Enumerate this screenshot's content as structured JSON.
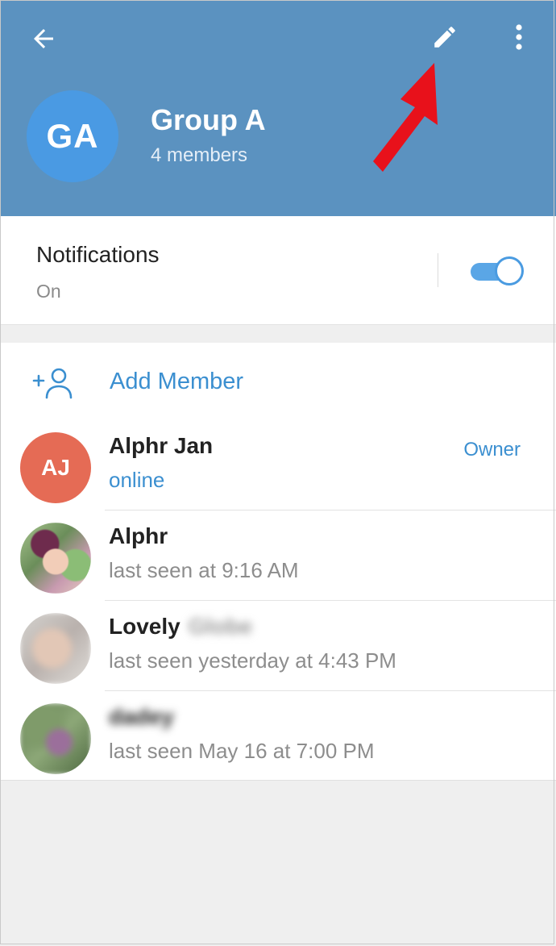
{
  "header": {
    "avatar_initials": "GA",
    "title": "Group A",
    "subtitle": "4 members",
    "colors": {
      "background": "#5b92c0",
      "avatar": "#4a9ae3"
    },
    "icons": {
      "back": "arrow-left-icon",
      "edit": "pencil-icon",
      "more": "more-vertical-icon"
    }
  },
  "notifications": {
    "title": "Notifications",
    "status": "On",
    "enabled": true
  },
  "members": {
    "add_label": "Add Member",
    "list": [
      {
        "initials": "AJ",
        "name": "Alphr Jan",
        "status": "online",
        "role": "Owner"
      },
      {
        "name": "Alphr",
        "status": "last seen at 9:16 AM"
      },
      {
        "name": "Lovely",
        "name_redacted": "Globe",
        "status": "last seen yesterday at 4:43 PM"
      },
      {
        "name_redacted": "dadey",
        "status": "last seen May 16 at 7:00 PM"
      }
    ]
  },
  "accent_color": "#3b8fd0"
}
